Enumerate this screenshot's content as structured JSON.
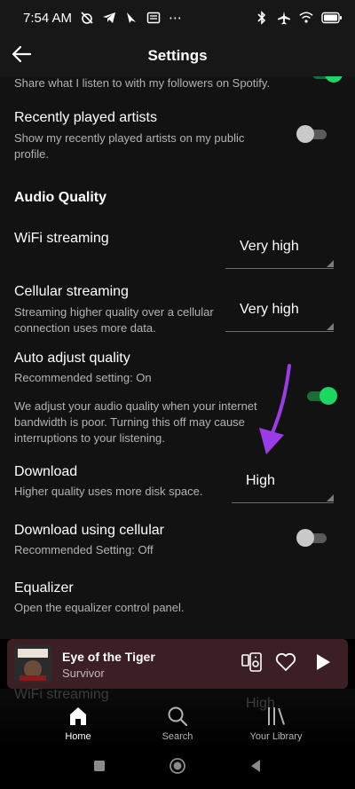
{
  "status_bar": {
    "time": "7:54 AM",
    "more": "⋯"
  },
  "app_bar": {
    "title": "Settings"
  },
  "settings": {
    "share_partial": "Share what I listen to with my followers on Spotify.",
    "recently_played": {
      "title": "Recently played artists",
      "subtitle": "Show my recently played artists on my public profile.",
      "enabled": false
    },
    "audio_quality_heading": "Audio Quality",
    "wifi_streaming": {
      "title": "WiFi streaming",
      "value": "Very high"
    },
    "cellular_streaming": {
      "title": "Cellular streaming",
      "subtitle": "Streaming higher quality over a cellular connection uses more data.",
      "value": "Very high"
    },
    "auto_adjust": {
      "title": "Auto adjust quality",
      "subtitle": "Recommended setting: On",
      "description": "We adjust your audio quality when your internet bandwidth is poor. Turning this off may cause interruptions to your listening.",
      "enabled": true
    },
    "download": {
      "title": "Download",
      "subtitle": "Higher quality uses more disk space.",
      "value": "High"
    },
    "download_cellular": {
      "title": "Download using cellular",
      "subtitle": "Recommended Setting: Off",
      "enabled": false
    },
    "equalizer": {
      "title": "Equalizer",
      "subtitle": "Open the equalizer control panel."
    }
  },
  "annotation": {
    "color": "#9b3de6"
  },
  "mini_player": {
    "title": "Eye of the Tiger",
    "artist": "Survivor",
    "background": "#3b1f25"
  },
  "behind_nav": {
    "wifi_title": "WiFi streaming",
    "wifi_value": "High"
  },
  "bottom_nav": {
    "items": [
      {
        "label": "Home",
        "active": true
      },
      {
        "label": "Search",
        "active": false
      },
      {
        "label": "Your Library",
        "active": false
      }
    ]
  },
  "colors": {
    "accent": "#1ed760",
    "background": "#121212"
  }
}
